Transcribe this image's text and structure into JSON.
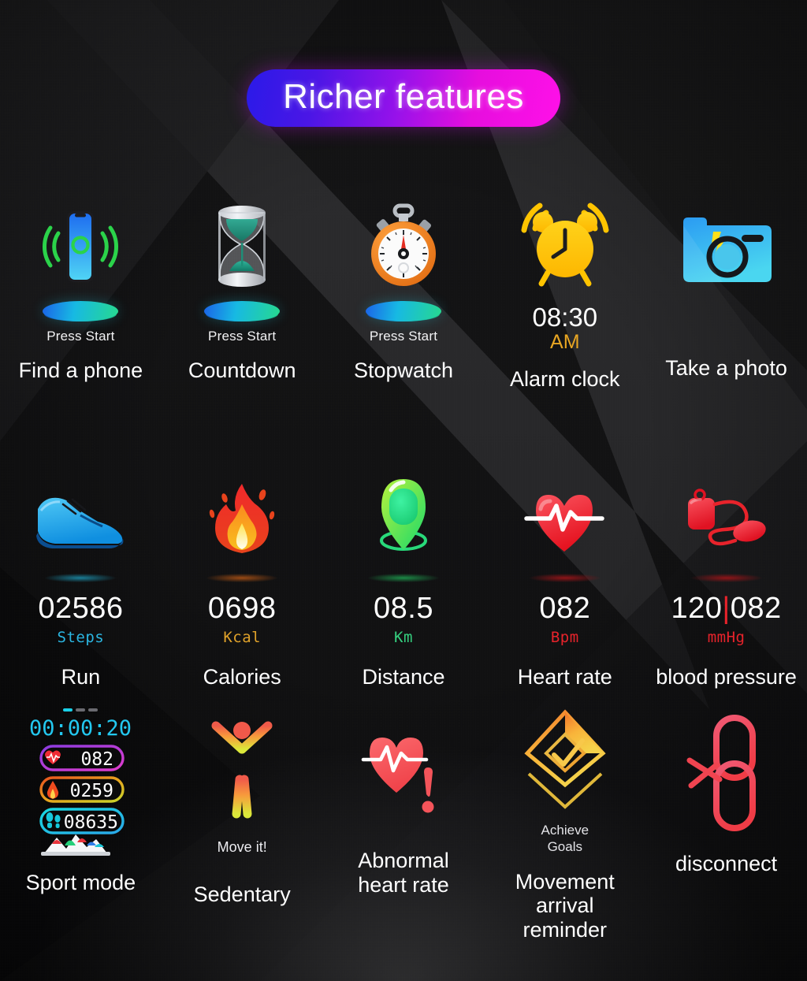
{
  "title": {
    "text": "Richer features"
  },
  "rows": [
    {
      "id": "row1",
      "items": [
        {
          "name": "find-a-phone",
          "icon": "phone-ring-icon",
          "sub": "Press Start",
          "label": "Find a phone"
        },
        {
          "name": "countdown",
          "icon": "hourglass-icon",
          "sub": "Press Start",
          "label": "Countdown"
        },
        {
          "name": "stopwatch",
          "icon": "stopwatch-icon",
          "sub": "Press Start",
          "label": "Stopwatch"
        },
        {
          "name": "alarm-clock",
          "icon": "alarm-clock-icon",
          "time": "08:30",
          "meridiem": "AM",
          "label": "Alarm clock"
        },
        {
          "name": "take-a-photo",
          "icon": "camera-icon",
          "label": "Take a photo"
        }
      ]
    },
    {
      "id": "row2",
      "items": [
        {
          "name": "run",
          "icon": "running-shoe-icon",
          "value": "02586",
          "unit": "Steps",
          "unit_color": "#2bb6e2",
          "glow": "#1a7d96",
          "label": "Run"
        },
        {
          "name": "calories",
          "icon": "flame-icon",
          "value": "0698",
          "unit": "Kcal",
          "unit_color": "#e0a22a",
          "glow": "#9a4a14",
          "label": "Calories"
        },
        {
          "name": "distance",
          "icon": "location-pin-icon",
          "value": "08.5",
          "unit": "Km",
          "unit_color": "#35d07f",
          "glow": "#1c8a46",
          "label": "Distance"
        },
        {
          "name": "heart-rate",
          "icon": "heart-pulse-icon",
          "value": "082",
          "unit": "Bpm",
          "unit_color": "#e8232b",
          "glow": "#8e1418",
          "label": "Heart rate"
        },
        {
          "name": "blood-pressure",
          "icon": "blood-pressure-icon",
          "value_sys": "120",
          "value_dia": "082",
          "unit": "mmHg",
          "unit_color": "#e8232b",
          "glow": "#8e1418",
          "label": "blood pressure"
        }
      ]
    },
    {
      "id": "row3",
      "items": [
        {
          "name": "sport-mode",
          "icon": "sport-mode-widget-icon",
          "label": "Sport mode"
        },
        {
          "name": "sedentary",
          "icon": "stick-figure-icon",
          "cap": "Move it!",
          "label": "Sedentary"
        },
        {
          "name": "abnormal-heart-rate",
          "icon": "heart-alert-icon",
          "label": "Abnormal\nheart rate"
        },
        {
          "name": "movement-arrival-reminder",
          "icon": "diamond-check-icon",
          "cap": "Achieve\nGoals",
          "label": "Movement arrival\nreminder"
        },
        {
          "name": "disconnect",
          "icon": "broken-chain-icon",
          "label": "disconnect"
        }
      ]
    }
  ],
  "sport_widget": {
    "timer": "00:00:20",
    "page_dots": 3,
    "stats": [
      {
        "icon": "heart-icon",
        "value": "082",
        "color": "#c23ad6"
      },
      {
        "icon": "flame-icon",
        "value": "0259",
        "color": "#e08a1e"
      },
      {
        "icon": "footsteps-icon",
        "value": "08635",
        "color": "#18d7e0"
      }
    ]
  }
}
